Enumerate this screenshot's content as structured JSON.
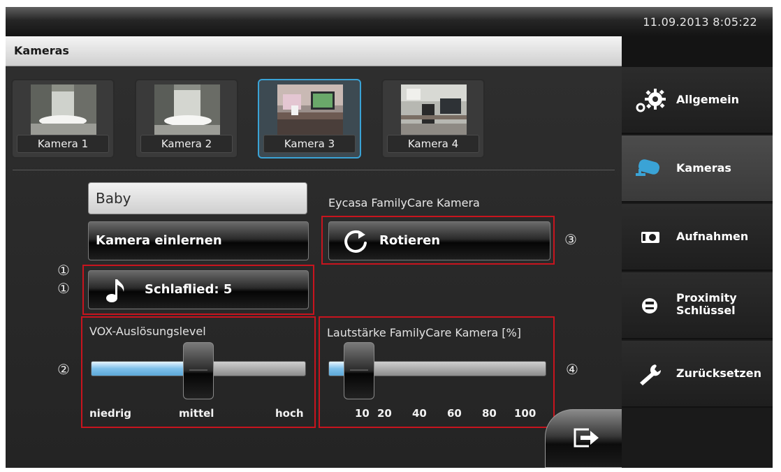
{
  "status_bar": {
    "datetime": "11.09.2013 8:05:22"
  },
  "page": {
    "title": "Kameras"
  },
  "cameras": [
    {
      "label": "Kamera 1",
      "selected": false
    },
    {
      "label": "Kamera 2",
      "selected": false
    },
    {
      "label": "Kamera 3",
      "selected": true
    },
    {
      "label": "Kamera 4",
      "selected": false
    }
  ],
  "settings": {
    "camera_name_value": "Baby",
    "device_name": "Eycasa FamilyCare Kamera",
    "learn_button": "Kamera einlernen",
    "rotate_button": "Rotieren",
    "lullaby_button": "Schlaflied: 5"
  },
  "vox": {
    "label": "VOX-Auslösungslevel",
    "ticks": [
      "niedrig",
      "mittel",
      "hoch"
    ],
    "value": "mittel"
  },
  "volume": {
    "label": "Lautstärke FamilyCare Kamera [%]",
    "ticks": [
      "10",
      "20",
      "40",
      "60",
      "80",
      "100"
    ],
    "value": 10
  },
  "annotations": {
    "lullaby_a": "①",
    "lullaby_b": "①",
    "vox": "②",
    "rotate": "③",
    "volume": "④"
  },
  "sidebar": {
    "items": [
      {
        "label": "Allgemein",
        "icon": "gears-icon",
        "active": false
      },
      {
        "label": "Kameras",
        "icon": "camera-icon",
        "active": true
      },
      {
        "label": "Aufnahmen",
        "icon": "recordings-icon",
        "active": false
      },
      {
        "label": "Proximity Schlüssel",
        "label_line1": "Proximity",
        "label_line2": "Schlüssel",
        "icon": "key-fob-icon",
        "active": false
      },
      {
        "label": "Zurücksetzen",
        "icon": "wrench-icon",
        "active": false
      }
    ]
  },
  "colors": {
    "accent_blue": "#3aa3d6",
    "annotation_red": "#c8141e",
    "slider_fill": "#7ec0ea"
  }
}
